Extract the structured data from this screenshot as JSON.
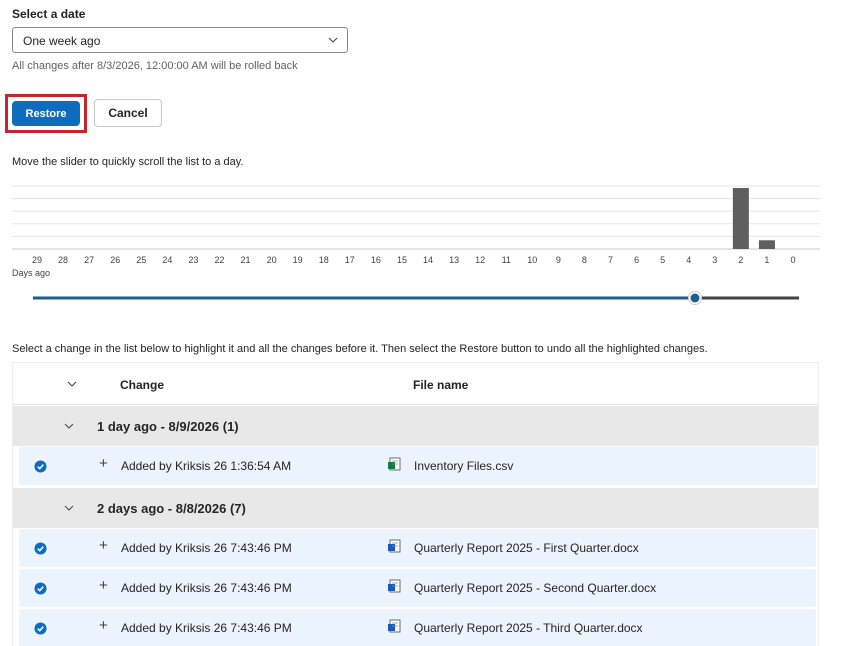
{
  "date_section": {
    "label": "Select a date",
    "selected": "One week ago",
    "hint": "All changes after 8/3/2026, 12:00:00 AM will be rolled back"
  },
  "buttons": {
    "restore": "Restore",
    "cancel": "Cancel"
  },
  "slider_hint": "Move the slider to quickly scroll the list to a day.",
  "chart_data": {
    "type": "bar",
    "categories": [
      "29",
      "28",
      "27",
      "26",
      "25",
      "24",
      "23",
      "22",
      "21",
      "20",
      "19",
      "18",
      "17",
      "16",
      "15",
      "14",
      "13",
      "12",
      "11",
      "10",
      "9",
      "8",
      "7",
      "6",
      "5",
      "4",
      "3",
      "2",
      "1",
      "0"
    ],
    "values": [
      0,
      0,
      0,
      0,
      0,
      0,
      0,
      0,
      0,
      0,
      0,
      0,
      0,
      0,
      0,
      0,
      0,
      0,
      0,
      0,
      0,
      0,
      0,
      0,
      0,
      0,
      0,
      7,
      1,
      0
    ],
    "xlabel": "Days ago",
    "ylabel": "",
    "ylim": [
      0,
      7
    ],
    "grid": true,
    "bar_color": "#5f5f5f"
  },
  "slider": {
    "value_days_ago": 2,
    "min": 0,
    "max": 29,
    "track_color": "#1f5d8a"
  },
  "instruction": "Select a change in the list below to highlight it and all the changes before it. Then select the Restore button to undo all the highlighted changes.",
  "table": {
    "col_change": "Change",
    "col_file": "File name",
    "groups": [
      {
        "title": "1 day ago - 8/9/2026 (1)",
        "rows": [
          {
            "change": "Added by Kriksis 26 1:36:54 AM",
            "file": "Inventory Files.csv",
            "icon": "csv-file-icon"
          }
        ]
      },
      {
        "title": "2 days ago - 8/8/2026 (7)",
        "rows": [
          {
            "change": "Added by Kriksis 26 7:43:46 PM",
            "file": "Quarterly Report 2025 - First Quarter.docx",
            "icon": "word-doc-icon"
          },
          {
            "change": "Added by Kriksis 26 7:43:46 PM",
            "file": "Quarterly Report 2025 - Second Quarter.docx",
            "icon": "word-doc-icon"
          },
          {
            "change": "Added by Kriksis 26 7:43:46 PM",
            "file": "Quarterly Report 2025 - Third Quarter.docx",
            "icon": "word-doc-icon"
          }
        ]
      }
    ]
  },
  "colors": {
    "accent": "#0f6cbd",
    "highlight_border": "#c4262e",
    "selected_row": "#ebf3fc",
    "group_header": "#e8e8e8"
  }
}
